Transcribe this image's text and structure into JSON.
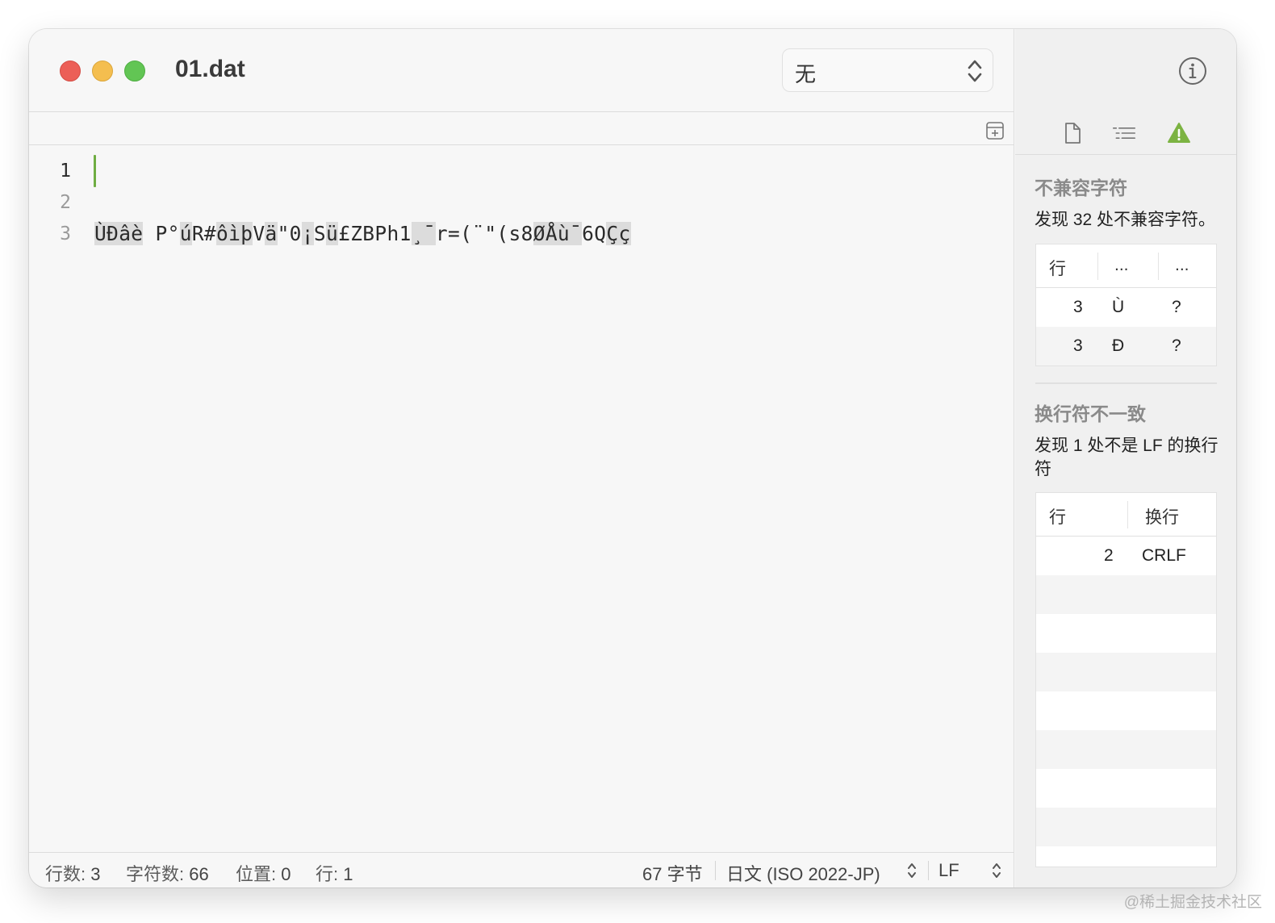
{
  "window": {
    "title": "01.dat"
  },
  "syntax": {
    "value": "无"
  },
  "editor": {
    "line_numbers": [
      "1",
      "2",
      "3"
    ],
    "line3_segments": [
      {
        "t": "ÙÐâè",
        "hl": true
      },
      {
        "t": " P°",
        "hl": false
      },
      {
        "t": "ú",
        "hl": true
      },
      {
        "t": "R#",
        "hl": false
      },
      {
        "t": "ôì",
        "hl": true
      },
      {
        "t": "þ",
        "hl": true
      },
      {
        "t": "V",
        "hl": false
      },
      {
        "t": "ä",
        "hl": true
      },
      {
        "t": "\"0",
        "hl": false
      },
      {
        "t": "¡",
        "hl": true
      },
      {
        "t": "S",
        "hl": false
      },
      {
        "t": "ü",
        "hl": true
      },
      {
        "t": "£ZBPh1",
        "hl": false
      },
      {
        "t": "¸¯",
        "hl": true
      },
      {
        "t": "r=(",
        "hl": false
      },
      {
        "t": "¨",
        "hl": false
      },
      {
        "t": "\"(s8",
        "hl": false
      },
      {
        "t": "ØÅù¯",
        "hl": true
      },
      {
        "t": "6Q",
        "hl": false
      },
      {
        "t": "Çç",
        "hl": true
      }
    ]
  },
  "status": {
    "lines_label": "行数:",
    "lines_value": "3",
    "chars_label": "字符数:",
    "chars_value": "66",
    "pos_label": "位置:",
    "pos_value": "0",
    "row_label": "行:",
    "row_value": "1",
    "bytes": "67 字节",
    "encoding": "日文 (ISO 2022-JP)",
    "line_ending": "LF"
  },
  "inspector": {
    "incompatible": {
      "title": "不兼容字符",
      "desc": "发现 32 处不兼容字符。",
      "headers": [
        "行",
        "...",
        "..."
      ],
      "rows": [
        {
          "line": "3",
          "char": "Ù",
          "converted": "?"
        },
        {
          "line": "3",
          "char": "Ð",
          "converted": "?"
        }
      ]
    },
    "line_endings": {
      "title": "换行符不一致",
      "desc": "发现 1 处不是 LF 的换行符",
      "headers": [
        "行",
        "换行"
      ],
      "rows": [
        {
          "line": "2",
          "ending": "CRLF"
        }
      ]
    }
  },
  "colors": {
    "accent_green": "#6fad42",
    "warning": "#7cb342",
    "close": "#ec5f57",
    "minimize": "#f4be4f",
    "zoom": "#62c554"
  },
  "icons": [
    "info-icon",
    "document-icon",
    "outline-icon",
    "warning-icon",
    "add-panel-icon",
    "stepper-arrows-icon"
  ],
  "watermark": "@稀土掘金技术社区"
}
